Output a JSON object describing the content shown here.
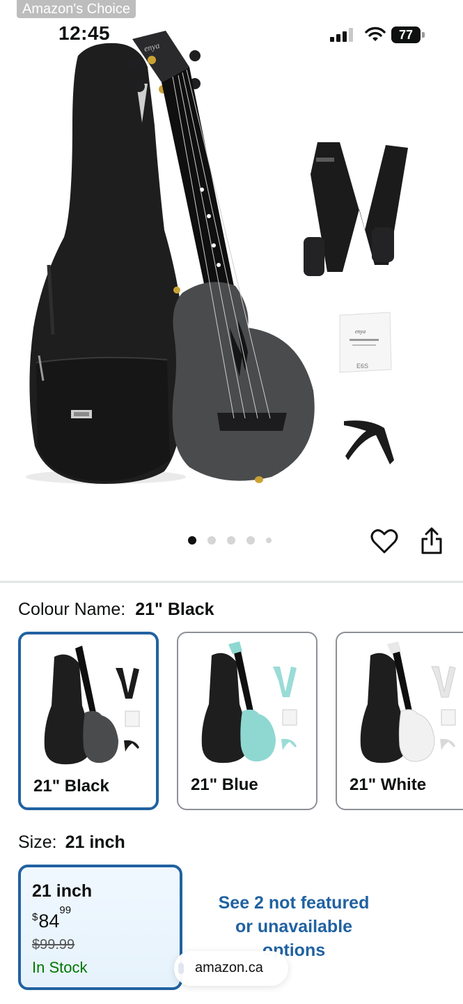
{
  "status_bar": {
    "badge": "Amazon's Choice",
    "time": "12:45",
    "battery": "77"
  },
  "gallery": {
    "icons": [
      "heart-icon",
      "share-icon"
    ],
    "dots_total": 5,
    "active_dot": 0
  },
  "colour": {
    "label": "Colour Name:",
    "selected": "21\" Black",
    "options": [
      {
        "label": "21\" Black",
        "body_color": "#4a4b4d",
        "selected": true
      },
      {
        "label": "21\" Blue",
        "body_color": "#8fd8d2",
        "selected": false
      },
      {
        "label": "21\" White",
        "body_color": "#f1f1f1",
        "selected": false
      }
    ]
  },
  "size": {
    "label": "Size:",
    "selected": "21 inch",
    "card": {
      "name": "21 inch",
      "currency": "$",
      "price_whole": "84",
      "price_fraction": "99",
      "old_price": "$99.99",
      "stock": "In Stock"
    },
    "see_more_line1": "See 2 not featured",
    "see_more_line2": "or unavailable",
    "see_more_line3": "options"
  },
  "browser": {
    "url": "amazon.ca"
  },
  "colors": {
    "accent": "#2162a1",
    "in_stock": "#007600",
    "product_grey": "#4a4b4d"
  }
}
